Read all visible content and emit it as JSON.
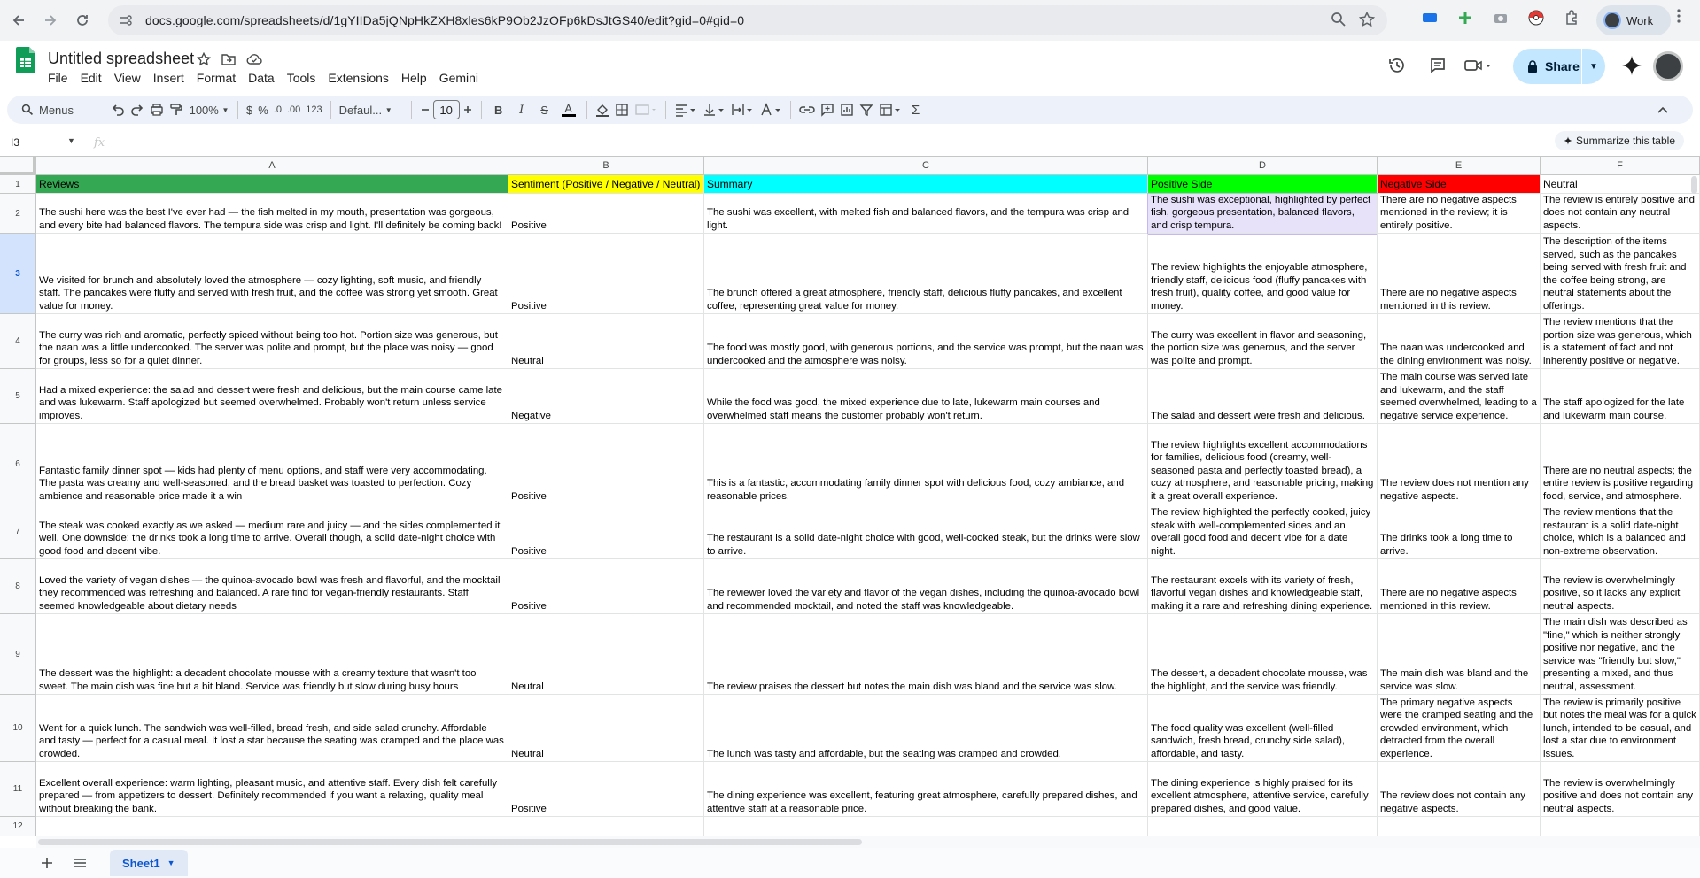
{
  "browser": {
    "url": "docs.google.com/spreadsheets/d/1gYIIDa5jQNpHkZXH8xles6kP9Ob2JzOFp6kDsJtGS40/edit?gid=0#gid=0",
    "profile_label": "Work",
    "icons": [
      "back-icon",
      "forward-icon",
      "reload-icon",
      "site-info-icon",
      "zoom-icon",
      "bookmark-star-icon"
    ]
  },
  "app": {
    "title": "Untitled spreadsheet",
    "menu": [
      "File",
      "Edit",
      "View",
      "Insert",
      "Format",
      "Data",
      "Tools",
      "Extensions",
      "Help",
      "Gemini"
    ],
    "share_label": "Share",
    "brand_color": "#0f9d58"
  },
  "toolbar": {
    "search_label": "Menus",
    "zoom": "100%",
    "currency": "$",
    "percent": "%",
    "dec_decrease": ".0",
    "dec_increase": ".00",
    "number_format": "123",
    "font": "Defaul...",
    "font_size": "10"
  },
  "formula": {
    "cell_ref": "I3",
    "fx": "fx",
    "summarize_label": "Summarize this table"
  },
  "grid": {
    "columns": [
      "A",
      "B",
      "C",
      "D",
      "E",
      "F"
    ],
    "row_numbers": [
      "1",
      "2",
      "3",
      "4",
      "5",
      "6",
      "7",
      "8",
      "9",
      "10",
      "11",
      "12"
    ],
    "selected_row": "3",
    "headers": [
      "Reviews",
      "Sentiment (Positive / Negative / Neutral)",
      "Summary",
      "Positive Side",
      "Negative Side",
      "Neutral"
    ],
    "header_colors": [
      "#34a853",
      "#ffff00",
      "#00ffff",
      "#00ff00",
      "#ff0000",
      "#ffffff"
    ],
    "rows": [
      {
        "review": "The sushi here was the best I've ever had — the fish melted in my mouth, presentation was gorgeous, and every bite had balanced flavors. The tempura side was crisp and light. I'll definitely be coming back!",
        "sentiment": "Positive",
        "summary": "The sushi was excellent, with melted fish and balanced flavors, and the tempura was crisp and light.",
        "positive": "The sushi was exceptional, highlighted by perfect fish, gorgeous presentation, balanced flavors, and crisp tempura.",
        "negative": "There are no negative aspects mentioned in the review; it is entirely positive.",
        "neutral": "The review is entirely positive and does not contain any neutral aspects."
      },
      {
        "review": "We visited for brunch and absolutely loved the atmosphere — cozy lighting, soft music, and friendly staff. The pancakes were fluffy and served with fresh fruit, and the coffee was strong yet smooth. Great value for money.",
        "sentiment": "Positive",
        "summary": "The brunch offered a great atmosphere, friendly staff, delicious fluffy pancakes, and excellent coffee, representing great value for money.",
        "positive": "The review highlights the enjoyable atmosphere, friendly staff, delicious food (fluffy pancakes with fresh fruit), quality coffee, and good value for money.",
        "negative": "There are no negative aspects mentioned in this review.",
        "neutral": "The description of the items served, such as the pancakes being served with fresh fruit and the coffee being strong, are neutral statements about the offerings."
      },
      {
        "review": "The curry was rich and aromatic, perfectly spiced without being too hot. Portion size was generous, but the naan was a little undercooked. The server was polite and prompt, but the place was noisy — good for groups, less so for a quiet dinner.",
        "sentiment": "Neutral",
        "summary": "The food was mostly good, with generous portions, and the service was prompt, but the naan was undercooked and the atmosphere was noisy.",
        "positive": "The curry was excellent in flavor and seasoning, the portion size was generous, and the server was polite and prompt.",
        "negative": "The naan was undercooked and the dining environment was noisy.",
        "neutral": "The review mentions that the portion size was generous, which is a statement of fact and not inherently positive or negative."
      },
      {
        "review": "Had a mixed experience: the salad and dessert were fresh and delicious, but the main course came late and was lukewarm. Staff apologized but seemed overwhelmed. Probably won't return unless service improves.",
        "sentiment": "Negative",
        "summary": "While the food was good, the mixed experience due to late, lukewarm main courses and overwhelmed staff means the customer probably won't return.",
        "positive": "The salad and dessert were fresh and delicious.",
        "negative": "The main course was served late and lukewarm, and the staff seemed overwhelmed, leading to a negative service experience.",
        "neutral": "The staff apologized for the late and lukewarm main course."
      },
      {
        "review": "Fantastic family dinner spot — kids had plenty of menu options, and staff were very accommodating. The pasta was creamy and well-seasoned, and the bread basket was toasted to perfection. Cozy ambience and reasonable price made it a win",
        "sentiment": "Positive",
        "summary": "This is a fantastic, accommodating family dinner spot with delicious food, cozy ambiance, and reasonable prices.",
        "positive": "The review highlights excellent accommodations for families, delicious food (creamy, well-seasoned pasta and perfectly toasted bread), a cozy atmosphere, and reasonable pricing, making it a great overall experience.",
        "negative": "The review does not mention any negative aspects.",
        "neutral": "There are no neutral aspects; the entire review is positive regarding food, service, and atmosphere."
      },
      {
        "review": "The steak was cooked exactly as we asked — medium rare and juicy — and the sides complemented it well. One downside: the drinks took a long time to arrive. Overall though, a solid date-night choice with good food and decent vibe.",
        "sentiment": "Positive",
        "summary": "The restaurant is a solid date-night choice with good, well-cooked steak, but the drinks were slow to arrive.",
        "positive": "The review highlighted the perfectly cooked, juicy steak with well-complemented sides and an overall good food and decent vibe for a date night.",
        "negative": "The drinks took a long time to arrive.",
        "neutral": "The review mentions that the restaurant is a solid date-night choice, which is a balanced and non-extreme observation."
      },
      {
        "review": "Loved the variety of vegan dishes — the quinoa-avocado bowl was fresh and flavorful, and the mocktail they recommended was refreshing and balanced. A rare find for vegan-friendly restaurants. Staff seemed knowledgeable about dietary needs",
        "sentiment": "Positive",
        "summary": "The reviewer loved the variety and flavor of the vegan dishes, including the quinoa-avocado bowl and recommended mocktail, and noted the staff was knowledgeable.",
        "positive": "The restaurant excels with its variety of fresh, flavorful vegan dishes and knowledgeable staff, making it a rare and refreshing dining experience.",
        "negative": "There are no negative aspects mentioned in this review.",
        "neutral": "The review is overwhelmingly positive, so it lacks any explicit neutral aspects."
      },
      {
        "review": "The dessert was the highlight: a decadent chocolate mousse with a creamy texture that wasn't too sweet. The main dish was fine but a bit bland. Service was friendly but slow during busy hours",
        "sentiment": "Neutral",
        "summary": "The review praises the dessert but notes the main dish was bland and the service was slow.",
        "positive": "The dessert, a decadent chocolate mousse, was the highlight, and the service was friendly.",
        "negative": "The main dish was bland and the service was slow.",
        "neutral": "The main dish was described as \"fine,\" which is neither strongly positive nor negative, and the service was \"friendly but slow,\" presenting a mixed, and thus neutral, assessment."
      },
      {
        "review": "Went for a quick lunch. The sandwich was well-filled, bread fresh, and side salad crunchy. Affordable and tasty — perfect for a casual meal. It lost a star because the seating was cramped and the place was crowded.",
        "sentiment": "Neutral",
        "summary": "The lunch was tasty and affordable, but the seating was cramped and crowded.",
        "positive": "The food quality was excellent (well-filled sandwich, fresh bread, crunchy side salad), affordable, and tasty.",
        "negative": "The primary negative aspects were the cramped seating and the crowded environment, which detracted from the overall experience.",
        "neutral": "The review is primarily positive but notes the meal was for a quick lunch, intended to be casual, and lost a star due to environment issues."
      },
      {
        "review": "Excellent overall experience: warm lighting, pleasant music, and attentive staff. Every dish felt carefully prepared — from appetizers to dessert. Definitely recommended if you want a relaxing, quality meal without breaking the bank.",
        "sentiment": "Positive",
        "summary": "The dining experience was excellent, featuring great atmosphere, carefully prepared dishes, and attentive staff at a reasonable price.",
        "positive": "The dining experience is highly praised for its excellent atmosphere, attentive service, carefully prepared dishes, and good value.",
        "negative": "The review does not contain any negative aspects.",
        "neutral": "The review is overwhelmingly positive and does not contain any neutral aspects."
      }
    ]
  },
  "sheets": {
    "active_tab": "Sheet1"
  }
}
